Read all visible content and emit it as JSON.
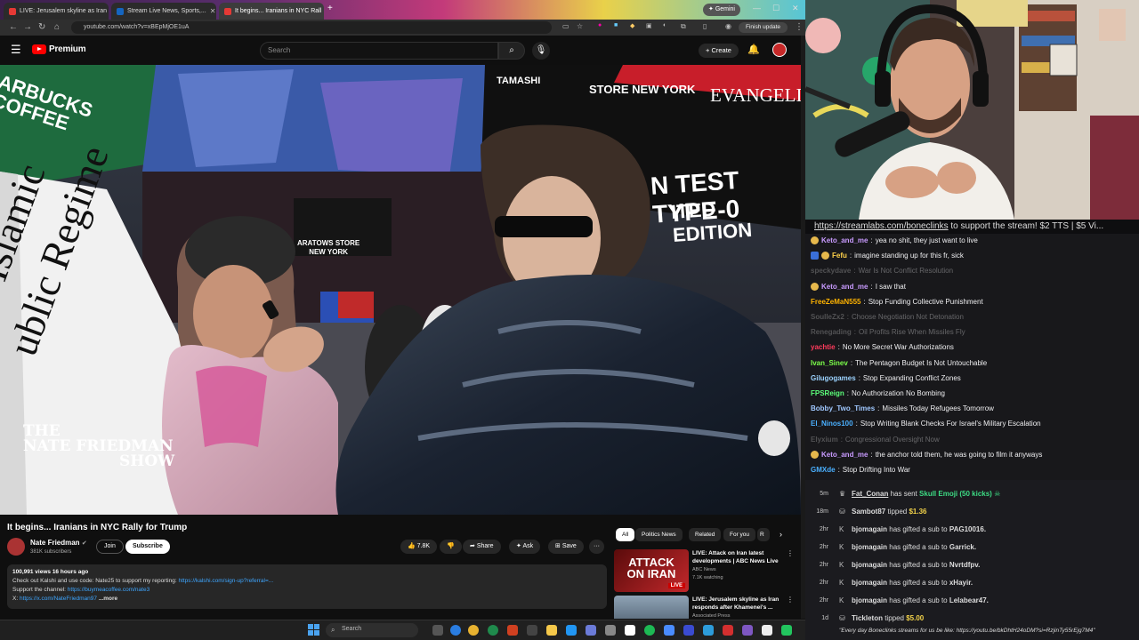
{
  "browser": {
    "tabs": [
      {
        "title": "LIVE: Jerusalem skyline as Iran"
      },
      {
        "title": "Stream Live News, Sports,..."
      },
      {
        "title": "It begins... Iranians in NYC Rall"
      }
    ],
    "gemini_label": "Gemini",
    "url": "youtube.com/watch?v=xBEpMjOE1uA",
    "finish_update": "Finish update"
  },
  "youtube": {
    "logo_text": "Premium",
    "search_placeholder": "Search",
    "create_label": "Create"
  },
  "video": {
    "title": "It begins... Iranians in NYC Rally for Trump",
    "watermark_line1": "THE",
    "watermark_line2": "NATE FRIEDMAN",
    "watermark_line3": "SHOW",
    "sign_text": "the Islamic\nublic Regime",
    "sign_line1": "the Islamic",
    "sign_line2": "ublic Regime",
    "billboard_left": "ARBUCKS\nCOFFEE",
    "billboard_left1": "ARBUCKS",
    "billboard_left2": "COFFEE",
    "billboard_evangelion": "EVANGELIO",
    "billboard_test": "N TEST TYPE-0",
    "billboard_edition": "ITED EDITION",
    "billboard_tamashi": "TAMASHI",
    "billboard_newyork": "STORE NEW YORK",
    "store_sign": "M&M'S STORE\nNEW YORK",
    "store_sign1": "ARATOWS STORE",
    "store_sign2": "NEW YORK"
  },
  "channel": {
    "name": "Nate Friedman",
    "subscribers": "381K subscribers",
    "join": "Join",
    "subscribe": "Subscribe"
  },
  "actions": {
    "likes": "7.8K",
    "share": "Share",
    "ask": "Ask",
    "save": "Save"
  },
  "description": {
    "stats": "100,991 views  16 hours ago",
    "line1": "Check out Kalshi and use code: Nate25 to support my reporting: ",
    "line1_link": "https://kalshi.com/sign-up?referral=...",
    "line2": "Support the channel: ",
    "line2_link": "https://buymeacoffee.com/nate3",
    "line3": "X: ",
    "line3_link": "https://x.com/NateFriedman97",
    "more": " ...more"
  },
  "chips": [
    "All",
    "Politics News",
    "Related",
    "For you",
    "R"
  ],
  "related": [
    {
      "title": "LIVE: Attack on Iran latest developments | ABC News Live",
      "channel": "ABC News",
      "meta": "7.1K watching",
      "thumb_text": "ATTACK ON IRAN",
      "badge": "LIVE"
    },
    {
      "title": "LIVE: Jerusalem skyline as Iran responds after Khamenei's ...",
      "channel": "Associated Press",
      "meta": ""
    }
  ],
  "stream": {
    "ticker_link": "https://streamlabs.com/boneclinks",
    "ticker_rest": " to support the stream! $2 TTS | $5 Vi..."
  },
  "chat": [
    {
      "user": "Keto_and_me",
      "text": "yea no shit, they just want to live",
      "color": "#c99bff",
      "badge": "circle",
      "dim": false
    },
    {
      "user": "Fefu",
      "text": "imagine standing up for this fr, sick",
      "color": "#ffd24a",
      "badge": "both",
      "dim": false
    },
    {
      "user": "speckydave",
      "text": "War Is Not Conflict Resolution",
      "color": "#bbbbbb",
      "badge": "none",
      "dim": true
    },
    {
      "user": "Keto_and_me",
      "text": "I saw that",
      "color": "#c99bff",
      "badge": "circle",
      "dim": false
    },
    {
      "user": "FreeZeMaN555",
      "text": "Stop Funding Collective Punishment",
      "color": "#ffb300",
      "badge": "none",
      "dim": false
    },
    {
      "user": "SoulleZx2",
      "text": "Choose Negotiation Not Detonation",
      "color": "#bbbbbb",
      "badge": "none",
      "dim": true
    },
    {
      "user": "Renegading",
      "text": "Oil Profits Rise When Missiles Fly",
      "color": "#bbbbbb",
      "badge": "none",
      "dim": true
    },
    {
      "user": "yachtie",
      "text": "No More Secret War Authorizations",
      "color": "#ff3b5c",
      "badge": "none",
      "dim": false
    },
    {
      "user": "Ivan_Sinev",
      "text": "The Pentagon Budget Is Not Untouchable",
      "color": "#7cff4a",
      "badge": "none",
      "dim": false
    },
    {
      "user": "Gilugogames",
      "text": "Stop Expanding Conflict Zones",
      "color": "#9cd3ff",
      "badge": "none",
      "dim": false
    },
    {
      "user": "FPSReign",
      "text": "No Authorization No Bombing",
      "color": "#5cff7a",
      "badge": "none",
      "dim": false
    },
    {
      "user": "Bobby_Two_Times",
      "text": "Missiles Today Refugees Tomorrow",
      "color": "#a0c8ff",
      "badge": "none",
      "dim": false
    },
    {
      "user": "El_Ninos100",
      "text": "Stop Writing Blank Checks For Israel's Military Escalation",
      "color": "#4ab0ff",
      "badge": "none",
      "dim": false
    },
    {
      "user": "Elyxium",
      "text": "Congressional Oversight Now",
      "color": "#bbbbbb",
      "badge": "none",
      "dim": true
    },
    {
      "user": "Keto_and_me",
      "text": "the anchor told them, he was going to film it anyways",
      "color": "#c99bff",
      "badge": "circle",
      "dim": false
    },
    {
      "user": "GMXde",
      "text": "Stop Drifting Into War",
      "color": "#4ab0ff",
      "badge": "none",
      "dim": false
    }
  ],
  "events": [
    {
      "time": "5m",
      "user": "Fat_Conan",
      "action": " has sent ",
      "highlight": "Skull Emoji (50 kicks)",
      "hl_color": "green",
      "suffix": ""
    },
    {
      "time": "18m",
      "user": "Sambot87",
      "action": " tipped ",
      "highlight": "$1.36",
      "hl_color": "yellow",
      "suffix": ""
    },
    {
      "time": "2hr",
      "user": "bjomagain",
      "action": " has gifted a sub to ",
      "highlight": "",
      "hl_color": "",
      "suffix": "PAG10016."
    },
    {
      "time": "2hr",
      "user": "bjomagain",
      "action": " has gifted a sub to ",
      "highlight": "",
      "hl_color": "",
      "suffix": "Garrick."
    },
    {
      "time": "2hr",
      "user": "bjomagain",
      "action": " has gifted a sub to ",
      "highlight": "",
      "hl_color": "",
      "suffix": "Nvrtdfpv."
    },
    {
      "time": "2hr",
      "user": "bjomagain",
      "action": " has gifted a sub to ",
      "highlight": "",
      "hl_color": "",
      "suffix": "xHayir."
    },
    {
      "time": "2hr",
      "user": "bjomagain",
      "action": " has gifted a sub to ",
      "highlight": "",
      "hl_color": "",
      "suffix": "Lelabear47."
    },
    {
      "time": "1d",
      "user": "Tickleton",
      "action": " tipped ",
      "highlight": "$5.00",
      "hl_color": "yellow",
      "suffix": ""
    }
  ],
  "event_quote": "\"Every day Boneclinks streams for us be like: https://youtu.be/bkDhtH24oDM?si=RzjinTy55rEjg7M4\"",
  "taskbar": {
    "search": "Search"
  },
  "colors": {
    "youtube_red": "#ff0000",
    "chat_bg": "#18181b",
    "link": "#3ea6ff"
  }
}
